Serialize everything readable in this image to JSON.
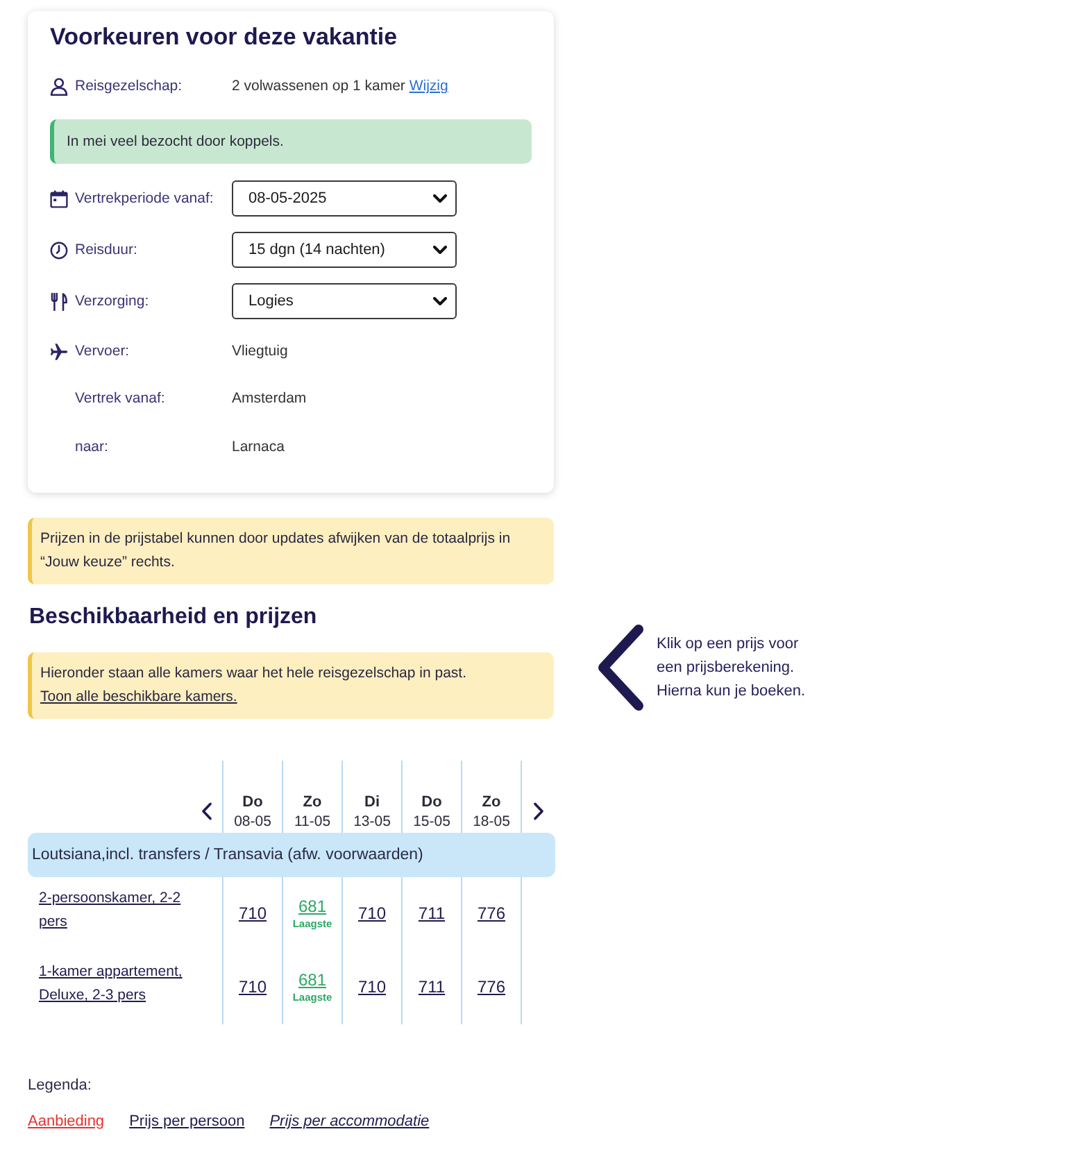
{
  "preferences": {
    "title": "Voorkeuren voor deze vakantie",
    "party": {
      "label": "Reisgezelschap:",
      "value": "2 volwassenen op 1 kamer",
      "link": "Wijzig"
    },
    "notice": "In mei veel bezocht door koppels.",
    "departure_period": {
      "label": "Vertrekperiode vanaf:",
      "value": "08-05-2025"
    },
    "duration": {
      "label": "Reisduur:",
      "value": "15 dgn (14 nachten)"
    },
    "board": {
      "label": "Verzorging:",
      "value": "Logies"
    },
    "transport": {
      "label": "Vervoer:",
      "value": "Vliegtuig"
    },
    "departure_from": {
      "label": "Vertrek vanaf:",
      "value": "Amsterdam"
    },
    "destination": {
      "label": "naar:",
      "value": "Larnaca"
    }
  },
  "price_notice": "Prijzen in de prijstabel kunnen door updates afwijken van de totaalprijs in “Jouw keuze” rechts.",
  "availability": {
    "title": "Beschikbaarheid en prijzen",
    "notice": "Hieronder staan alle kamers waar het hele reisgezelschap in past.",
    "notice_link": "Toon alle beschikbare kamers.",
    "hint": "Klik op een prijs voor een prijsberekening. Hierna kun je boeken."
  },
  "price_table": {
    "columns": [
      {
        "day": "Do",
        "date": "08-05"
      },
      {
        "day": "Zo",
        "date": "11-05"
      },
      {
        "day": "Di",
        "date": "13-05"
      },
      {
        "day": "Do",
        "date": "15-05"
      },
      {
        "day": "Zo",
        "date": "18-05"
      }
    ],
    "group": "Loutsiana,incl. transfers / Transavia (afw. voorwaarden)",
    "rows": [
      {
        "room": "2-persoonskamer, 2-2 pers",
        "cells": [
          {
            "price": "710",
            "lowest": false
          },
          {
            "price": "681",
            "lowest": true,
            "badge": "Laagste"
          },
          {
            "price": "710",
            "lowest": false
          },
          {
            "price": "711",
            "lowest": false
          },
          {
            "price": "776",
            "lowest": false
          }
        ]
      },
      {
        "room": "1-kamer appartement, Deluxe, 2-3 pers",
        "cells": [
          {
            "price": "710",
            "lowest": false
          },
          {
            "price": "681",
            "lowest": true,
            "badge": "Laagste"
          },
          {
            "price": "710",
            "lowest": false
          },
          {
            "price": "711",
            "lowest": false
          },
          {
            "price": "776",
            "lowest": false
          }
        ]
      }
    ]
  },
  "legend": {
    "title": "Legenda:",
    "items": [
      {
        "kind": "offer",
        "label": "Aanbieding"
      },
      {
        "kind": "per_person",
        "label": "Prijs per persoon"
      },
      {
        "kind": "per_accommodation",
        "label": "Prijs per accommodatie"
      }
    ]
  }
}
